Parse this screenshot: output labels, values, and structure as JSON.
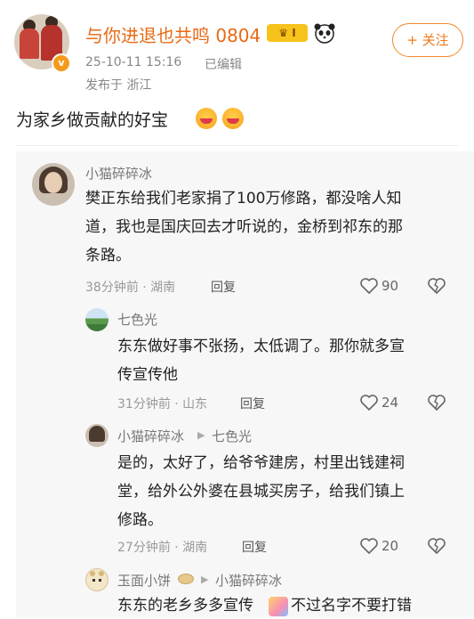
{
  "post": {
    "username": "与你进退也共鸣 0804",
    "level_badge": "I",
    "time": "25-10-11 15:16",
    "edited": "已编辑",
    "location": "发布于 浙江",
    "text": "为家乡做贡献的好宝",
    "follow_label": "+ 关注"
  },
  "comment": {
    "name": "小猫碎碎冰",
    "lines": [
      "樊正东给我们老家捐了100万修路，都没啥人知",
      "道，我也是国庆回去才听说的，金桥到祁东的那",
      "条路。"
    ],
    "meta": "38分钟前 · 湖南",
    "reply_label": "回复",
    "likes": "90"
  },
  "replies": [
    {
      "name": "七色光",
      "lines": [
        "东东做好事不张扬，太低调了。那你就多宣",
        "传宣传他"
      ],
      "meta": "31分钟前 · 山东",
      "reply_label": "回复",
      "likes": "24"
    },
    {
      "name": "小猫碎碎冰",
      "to": "七色光",
      "lines": [
        "是的，太好了，给爷爷建房，村里出钱建祠",
        "堂，给外公外婆在县城买房子，给我们镇上",
        "修路。"
      ],
      "meta": "27分钟前 · 湖南",
      "reply_label": "回复",
      "likes": "20"
    },
    {
      "name": "玉面小饼",
      "to": "小猫碎碎冰",
      "line_a": "东东的老乡多多宣传",
      "line_b": "不过名字不要打错"
    }
  ],
  "colors": {
    "accent": "#e86a16",
    "background": "#ffffff",
    "comment_bg": "#f7f7f7"
  }
}
